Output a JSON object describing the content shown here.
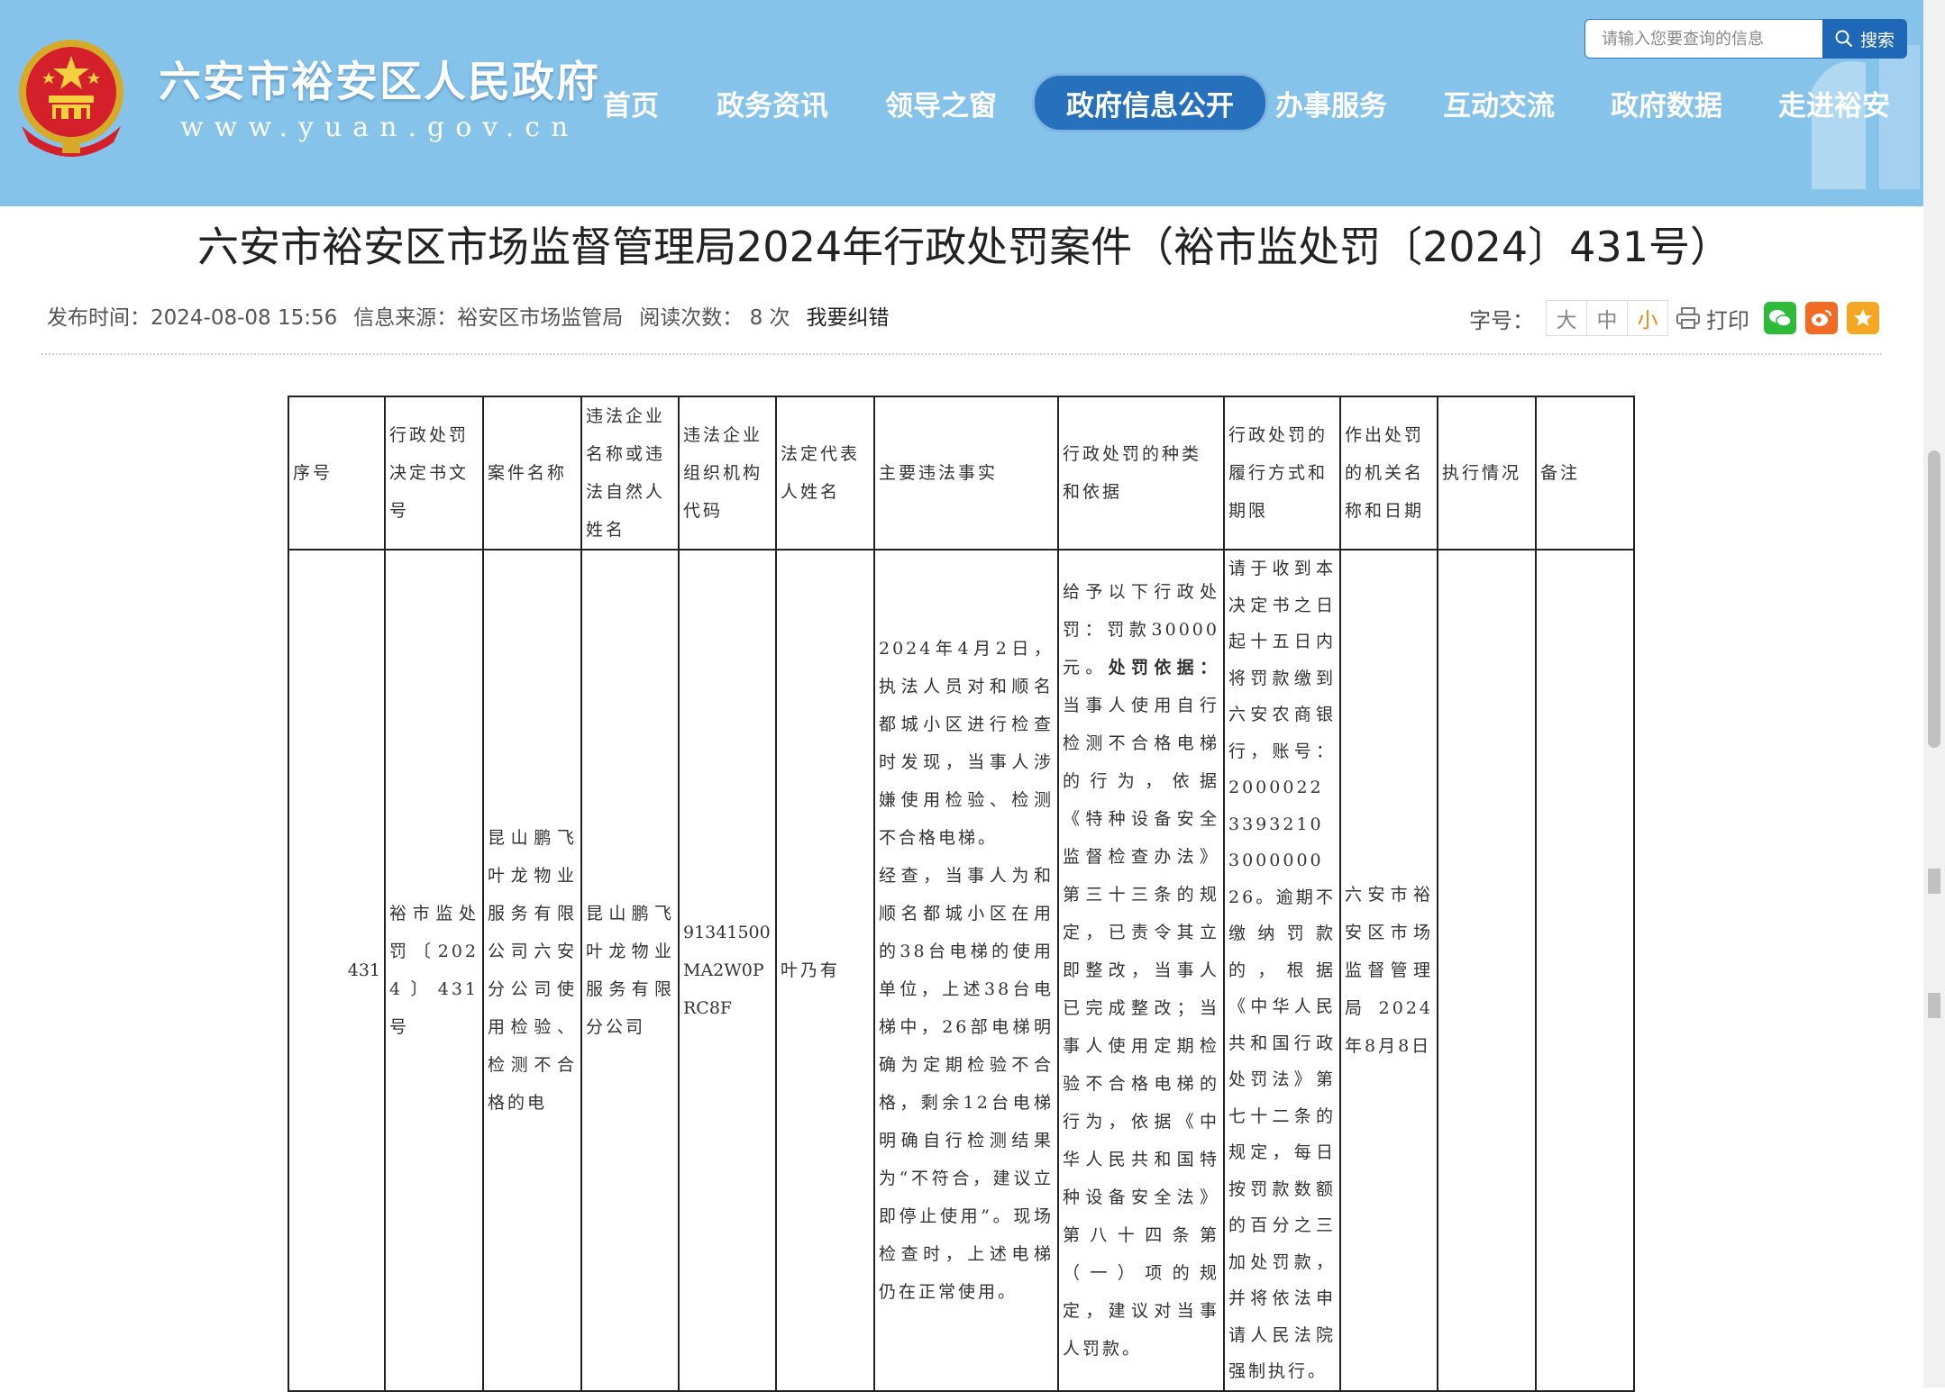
{
  "header": {
    "site_title": "六安市裕安区人民政府",
    "site_url": "www.yuan.gov.cn",
    "search": {
      "placeholder": "请输入您要查询的信息",
      "button_label": "搜索"
    },
    "nav": [
      {
        "label": "首页"
      },
      {
        "label": "政务资讯"
      },
      {
        "label": "领导之窗"
      },
      {
        "label": "政府信息公开",
        "active": true
      },
      {
        "label": "办事服务"
      },
      {
        "label": "互动交流"
      },
      {
        "label": "政府数据"
      },
      {
        "label": "走进裕安"
      }
    ],
    "colors": {
      "banner": "#86c3ea",
      "active_nav": "#2670bc",
      "search_button": "#1f68b8"
    }
  },
  "article": {
    "title": "六安市裕安区市场监督管理局2024年行政处罚案件（裕市监处罚〔2024〕431号）",
    "meta": {
      "publish_time": "发布时间：2024-08-08 15:56",
      "source": "信息来源：裕安区市场监管局",
      "views": "阅读次数：  8 次",
      "correct_link": "我要纠错"
    },
    "tools": {
      "font_label": "字号：",
      "font_large": "大",
      "font_medium": "中",
      "font_small": "小",
      "print_label": "打印",
      "share_icons": [
        "wechat-icon",
        "weibo-icon",
        "favorite-star-icon"
      ]
    }
  },
  "table": {
    "headers": [
      "序号",
      "行政处罚决定书文号",
      "案件名称",
      "违法企业名称或违法自然人姓名",
      "违法企业组织机构代码",
      "法定代表人姓名",
      "主要违法事实",
      "行政处罚的种类和依据",
      "行政处罚的履行方式和期限",
      "作出处罚的机关名称和日期",
      "执行情况",
      "备注"
    ],
    "row": {
      "seq": "431",
      "doc_no": "裕市监处罚〔2024〕431号",
      "case_name": "昆山鹏飞叶龙物业服务有限公司六安分公司使用检验、检测不合格的电",
      "party_name": "昆山鹏飞叶龙物业服务有限分公司",
      "org_code": "91341500MA2W0PRC8F",
      "legal_rep": "叶乃有",
      "facts_p1": "2024年4月2日，执法人员对和顺名都城小区进行检查时发现，当事人涉嫌使用检验、检测不合格电梯。",
      "facts_p2": "经查，当事人为和顺名都城小区在用的38台电梯的使用单位，上述38台电梯中，26部电梯明确为定期检验不合格，剩余12台电梯明确自行检测结果为“不符合，建议立即停止使用”。现场检查时，上述电梯仍在正常使用。",
      "penalty_p1": "给予以下行政处罚：罚款30000元。",
      "penalty_basis_label": "处罚依据：",
      "penalty_basis": "当事人使用自行检测不合格电梯的行为，依据《特种设备安全监督检查办法》第三十三条的规定，已责令其立即整改，当事人已完成整改；当事人使用定期检验不合格电梯的行为，依据《中华人民共和国特种设备安全法》第八十四条第（一）项的规定，建议对当事人罚款。",
      "fulfillment": "请于收到本决定书之日起十五日内将罚款缴到六安农商银行，账号：20000223393210300000026。逾期不缴纳罚款的，根据《中华人民共和国行政处罚法》第七十二条的规定，每日按罚款数额的百分之三加处罚款，并将依法申请人民法院强制执行。",
      "authority": "六安市裕安区市场监督管理局2024年8月8日",
      "execution": "",
      "remark": ""
    }
  }
}
